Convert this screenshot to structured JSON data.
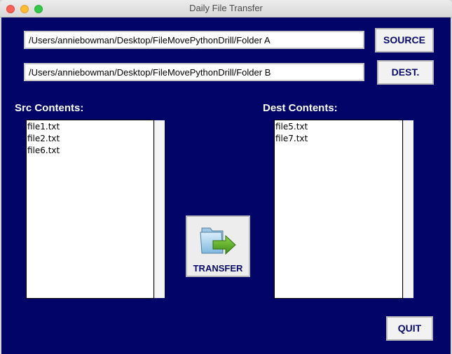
{
  "window": {
    "title": "Daily File Transfer"
  },
  "source": {
    "path": "/Users/anniebowman/Desktop/FileMovePythonDrill/Folder A",
    "button_label": "SOURCE"
  },
  "dest": {
    "path": "/Users/anniebowman/Desktop/FileMovePythonDrill/Folder B",
    "button_label": "DEST."
  },
  "src_list": {
    "label": "Src Contents:",
    "items": [
      "file1.txt",
      "file2.txt",
      "file6.txt"
    ]
  },
  "dest_list": {
    "label": "Dest Contents:",
    "items": [
      "file5.txt",
      "file7.txt"
    ]
  },
  "transfer": {
    "label": "TRANSFER",
    "icon": "folder-transfer-icon"
  },
  "quit": {
    "label": "QUIT"
  },
  "colors": {
    "background": "#020468",
    "button_text": "#0a0a6a"
  }
}
